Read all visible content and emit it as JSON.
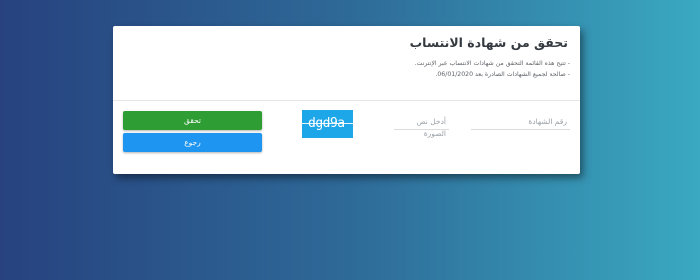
{
  "card": {
    "title": "تحقق من شهادة الانتساب",
    "notes": [
      "- تتيح هذه القائمة التحقق من شهادات الانتساب عبر الإنترنت.",
      "- صالحة لجميع الشهادات الصادرة بعد 06/01/2020."
    ]
  },
  "form": {
    "certificate_placeholder": "رقم الشهادة",
    "captcha_input_placeholder": "أدخل نص الصورة",
    "captcha_text": "dgd9a"
  },
  "buttons": {
    "verify_label": "تحقق",
    "back_label": "رجوع"
  },
  "colors": {
    "verify": "#2e9e34",
    "back": "#1e95f0",
    "captcha_bg": "#1ea7e8"
  }
}
